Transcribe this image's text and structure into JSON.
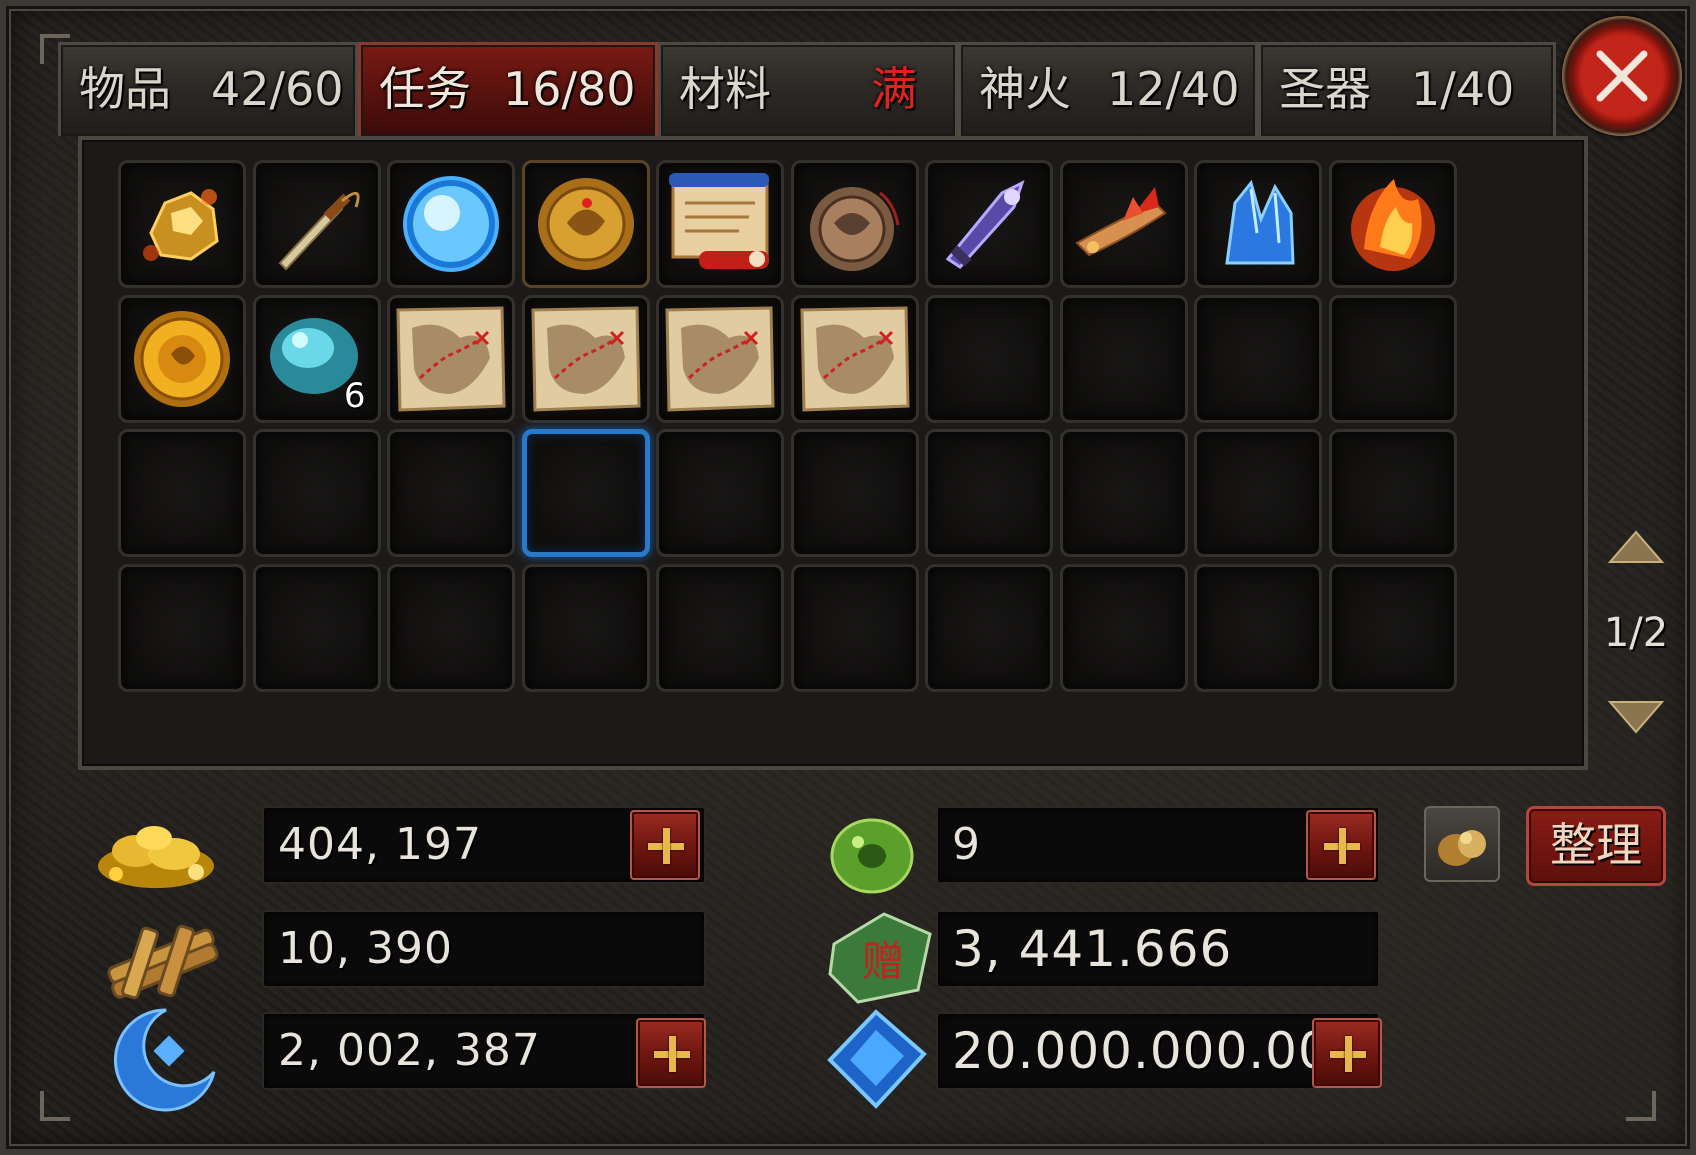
{
  "tabs": [
    {
      "name": "物品",
      "count": "42/60",
      "active": false,
      "full": false
    },
    {
      "name": "任务",
      "count": "16/80",
      "active": true,
      "full": false
    },
    {
      "name": "材料",
      "count": "满",
      "active": false,
      "full": true
    },
    {
      "name": "神火",
      "count": "12/40",
      "active": false,
      "full": false
    },
    {
      "name": "圣器",
      "count": "1/40",
      "active": false,
      "full": false
    }
  ],
  "grid": {
    "rows": 4,
    "cols": 10,
    "selected_slot": 23
  },
  "items": [
    {
      "icon": "gold-ore-icon"
    },
    {
      "icon": "dagger-icon"
    },
    {
      "icon": "blue-orb-icon"
    },
    {
      "icon": "gold-medallion-icon"
    },
    {
      "icon": "scroll-icon"
    },
    {
      "icon": "bronze-pendant-icon"
    },
    {
      "icon": "purple-blade-icon"
    },
    {
      "icon": "feathered-fan-icon"
    },
    {
      "icon": "blue-crystal-icon"
    },
    {
      "icon": "fire-stone-icon"
    },
    {
      "icon": "gold-coin-icon"
    },
    {
      "icon": "teal-stone-icon",
      "qty": "6"
    },
    {
      "icon": "treasure-map-icon"
    },
    {
      "icon": "treasure-map-icon"
    },
    {
      "icon": "treasure-map-icon"
    },
    {
      "icon": "treasure-map-icon"
    }
  ],
  "pager": {
    "label": "1/2"
  },
  "currencies": {
    "gold": {
      "icon": "gold-pile-icon",
      "value": "404, 197"
    },
    "wood": {
      "icon": "wood-bundle-icon",
      "value": "10, 390"
    },
    "moon": {
      "icon": "crescent-moon-icon",
      "value": "2, 002, 387"
    },
    "jade": {
      "icon": "green-jade-icon",
      "value": "9"
    },
    "gift": {
      "icon": "gift-token-icon",
      "value": "3, 441.666"
    },
    "diamond": {
      "icon": "blue-diamond-icon",
      "value": "20.000.000.00"
    }
  },
  "sort_button": {
    "label": "整理"
  },
  "colors": {
    "active_tab": "#7a1a14",
    "full_text": "#e0241c",
    "selection": "#2a78c8",
    "plus_button": "#9a2b22"
  }
}
